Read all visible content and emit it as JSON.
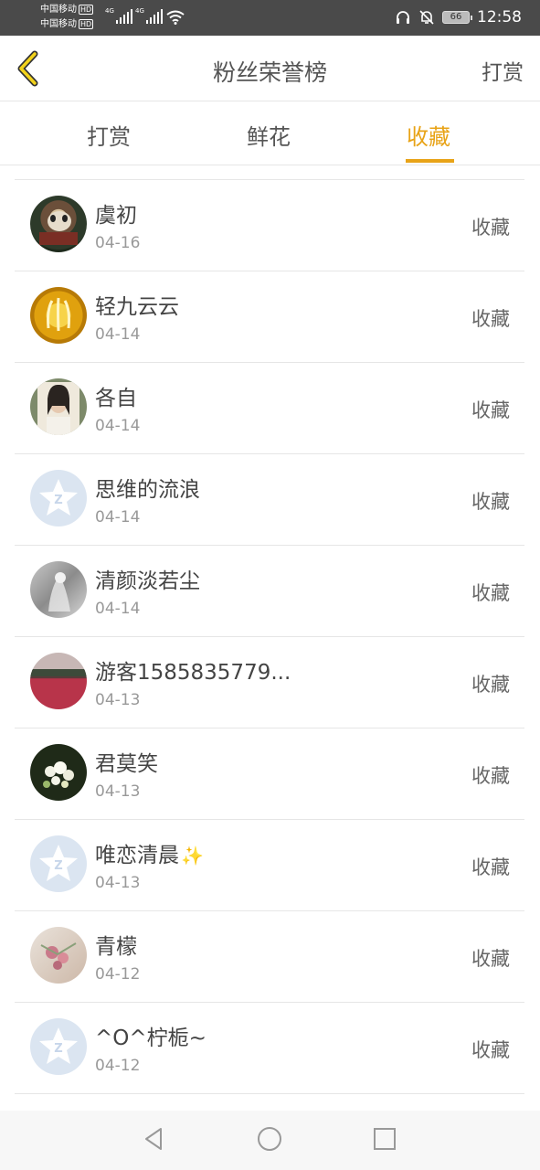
{
  "status_bar": {
    "carrier_1": "中国移动",
    "carrier_2": "中国移动",
    "hd": "HD",
    "net": "4G",
    "battery": "66",
    "time": "12:58"
  },
  "nav": {
    "title": "粉丝荣誉榜",
    "action": "打赏"
  },
  "tabs": [
    {
      "label": "打赏",
      "active": false
    },
    {
      "label": "鲜花",
      "active": false
    },
    {
      "label": "收藏",
      "active": true
    }
  ],
  "list": [
    {
      "name": "虞初",
      "date": "04-16",
      "action": "收藏",
      "avatar": "photo-dog"
    },
    {
      "name": "轻九云云",
      "date": "04-14",
      "action": "收藏",
      "avatar": "photo-yellow"
    },
    {
      "name": "各自",
      "date": "04-14",
      "action": "收藏",
      "avatar": "photo-girl"
    },
    {
      "name": "思维的流浪",
      "date": "04-14",
      "action": "收藏",
      "avatar": "default-avatar"
    },
    {
      "name": "清颜淡若尘",
      "date": "04-14",
      "action": "收藏",
      "avatar": "photo-grey"
    },
    {
      "name": "游客1585835779...",
      "date": "04-13",
      "action": "收藏",
      "avatar": "photo-flowers-field"
    },
    {
      "name": "君莫笑",
      "date": "04-13",
      "action": "收藏",
      "avatar": "photo-white-flowers"
    },
    {
      "name": "唯恋清晨",
      "date": "04-13",
      "action": "收藏",
      "avatar": "default-avatar",
      "emoji": "✨"
    },
    {
      "name": "青檬",
      "date": "04-12",
      "action": "收藏",
      "avatar": "photo-pink-flowers"
    },
    {
      "name": "^O^柠栀~",
      "date": "04-12",
      "action": "收藏",
      "avatar": "default-avatar"
    }
  ],
  "colors": {
    "accent": "#e8a317",
    "status_bar": "#4a4a4a",
    "divider": "#e6e6e6"
  }
}
